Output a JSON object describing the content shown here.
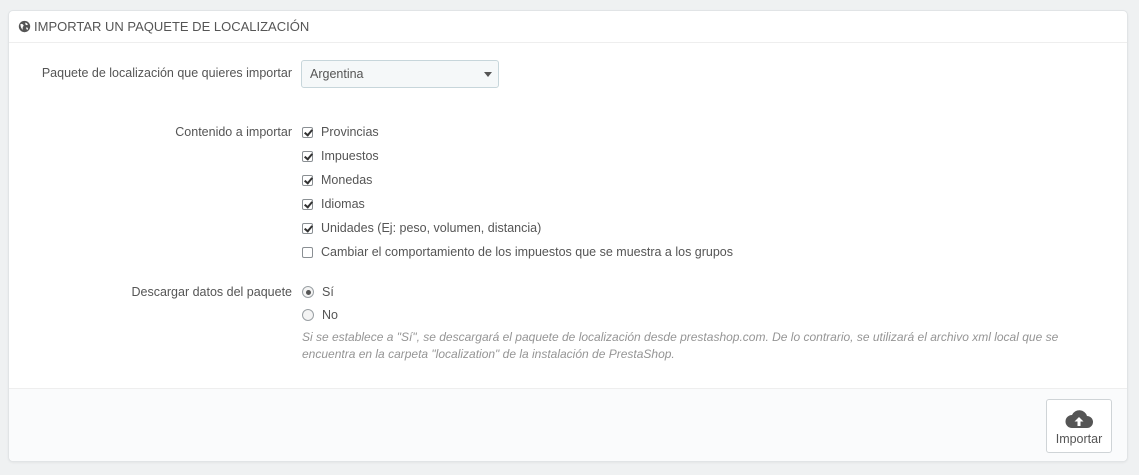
{
  "panel": {
    "title": "IMPORTAR UN PAQUETE DE LOCALIZACIÓN",
    "title_icon": "globe-icon"
  },
  "form": {
    "pack_label": "Paquete de localización que quieres importar",
    "pack_selected": "Argentina",
    "content_label": "Contenido a importar",
    "content_items": [
      {
        "label": "Provincias",
        "checked": true
      },
      {
        "label": "Impuestos",
        "checked": true
      },
      {
        "label": "Monedas",
        "checked": true
      },
      {
        "label": "Idiomas",
        "checked": true
      },
      {
        "label": "Unidades (Ej: peso, volumen, distancia)",
        "checked": true
      },
      {
        "label": "Cambiar el comportamiento de los impuestos que se muestra a los grupos",
        "checked": false
      }
    ],
    "download_label": "Descargar datos del paquete",
    "download_options": [
      {
        "label": "Sí",
        "checked": true
      },
      {
        "label": "No",
        "checked": false
      }
    ],
    "help_text": "Si se establece a \"Sí\", se descargará el paquete de localización desde prestashop.com. De lo contrario, se utilizará el archivo xml local que se encuentra en la carpeta \"localization\" de la instalación de PrestaShop."
  },
  "footer": {
    "import_label": "Importar",
    "import_icon": "cloud-upload-icon"
  }
}
